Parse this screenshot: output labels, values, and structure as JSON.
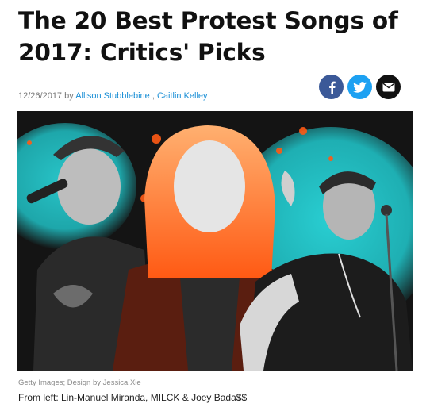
{
  "article": {
    "title_line1": "The 20 Best Protest Songs of",
    "title_line2": "2017: Critics' Picks",
    "date": "12/26/2017",
    "by_word": "by",
    "author1": "Allison Stubblebine",
    "author_separator": ",",
    "author2": "Caitlin Kelley"
  },
  "share": {
    "facebook": {
      "icon": "facebook-icon",
      "color": "#3b5998"
    },
    "twitter": {
      "icon": "twitter-icon",
      "color": "#1da1f2"
    },
    "email": {
      "icon": "envelope-icon",
      "color": "#111111"
    }
  },
  "hero": {
    "accent_orange": "#ff5a14",
    "accent_cyan": "#2ad8dc"
  },
  "photo_credit": "Getty Images; Design by Jessica Xie",
  "caption": "From left: Lin-Manuel Miranda, MILCK & Joey Bada$$"
}
